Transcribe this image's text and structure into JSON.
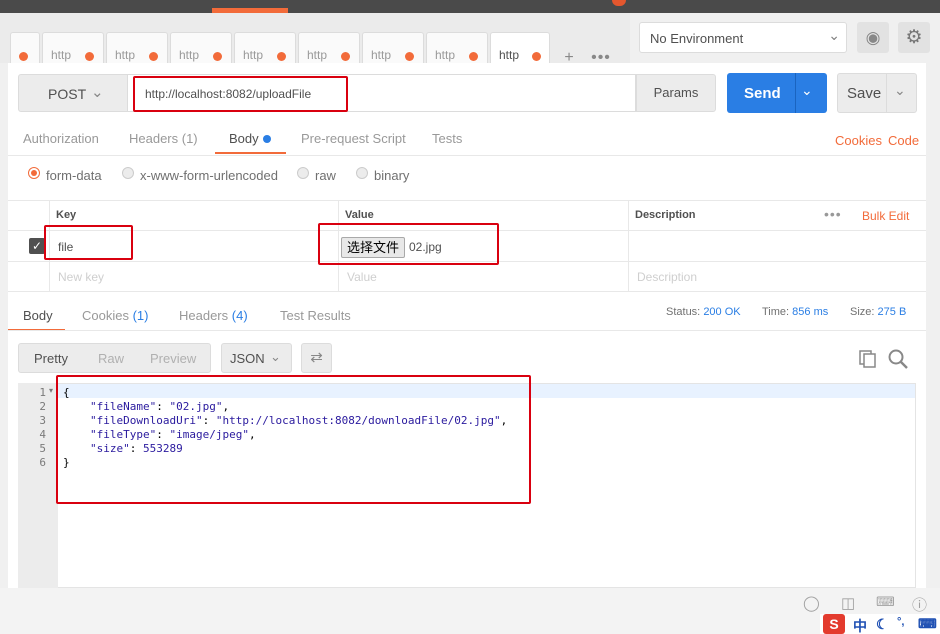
{
  "tabs": [
    {
      "label": "http"
    },
    {
      "label": "http"
    },
    {
      "label": "http"
    },
    {
      "label": "http"
    },
    {
      "label": "http"
    },
    {
      "label": "http"
    },
    {
      "label": "http"
    },
    {
      "label": "http"
    }
  ],
  "tab_add": "+",
  "tab_more": "•••",
  "environment": {
    "selected": "No Environment"
  },
  "request": {
    "method": "POST",
    "url": "http://localhost:8082/uploadFile",
    "params_label": "Params",
    "send_label": "Send",
    "save_label": "Save"
  },
  "request_tabs": {
    "authorization": "Authorization",
    "headers": "Headers (1)",
    "body": "Body",
    "prerequest": "Pre-request Script",
    "tests": "Tests",
    "cookies": "Cookies",
    "code": "Code"
  },
  "body_modes": {
    "form_data": "form-data",
    "urlencoded": "x-www-form-urlencoded",
    "raw": "raw",
    "binary": "binary",
    "selected": "form-data"
  },
  "kv_table": {
    "headers": {
      "key": "Key",
      "value": "Value",
      "description": "Description"
    },
    "bulk_edit": "Bulk Edit",
    "more": "•••",
    "row": {
      "key": "file",
      "file_button": "选择文件",
      "file_name": "02.jpg",
      "checked": true
    },
    "placeholders": {
      "key": "New key",
      "value": "Value",
      "description": "Description"
    }
  },
  "response_tabs": {
    "body": "Body",
    "cookies": "Cookies",
    "cookies_count": "(1)",
    "headers": "Headers",
    "headers_count": "(4)",
    "test_results": "Test Results"
  },
  "status": {
    "status_label": "Status:",
    "status_value": "200 OK",
    "time_label": "Time:",
    "time_value": "856 ms",
    "size_label": "Size:",
    "size_value": "275 B"
  },
  "format": {
    "pretty": "Pretty",
    "raw": "Raw",
    "preview": "Preview",
    "type": "JSON"
  },
  "response_lines": [
    {
      "n": "1",
      "text": "{"
    },
    {
      "n": "2",
      "key": "\"fileName\"",
      "sep": ": ",
      "val": "\"02.jpg\"",
      "end": ","
    },
    {
      "n": "3",
      "key": "\"fileDownloadUri\"",
      "sep": ": ",
      "val": "\"http://localhost:8082/downloadFile/02.jpg\"",
      "end": ","
    },
    {
      "n": "4",
      "key": "\"fileType\"",
      "sep": ": ",
      "val": "\"image/jpeg\"",
      "end": ","
    },
    {
      "n": "5",
      "key": "\"size\"",
      "sep": ": ",
      "val": "553289",
      "end": ""
    },
    {
      "n": "6",
      "text": "}"
    }
  ],
  "ime": {
    "logo": "S",
    "lang": "中"
  },
  "colors": {
    "accent": "#f26b3a",
    "primary": "#2a7ee4",
    "annotation": "#d9000f"
  },
  "icons": [
    "eye-icon",
    "gear-icon",
    "chevron-down-icon",
    "checkmark-icon",
    "wrap-lines-icon",
    "copy-icon",
    "search-icon",
    "lightbulb-icon",
    "two-pane-icon",
    "keyboard-icon",
    "help-icon"
  ]
}
